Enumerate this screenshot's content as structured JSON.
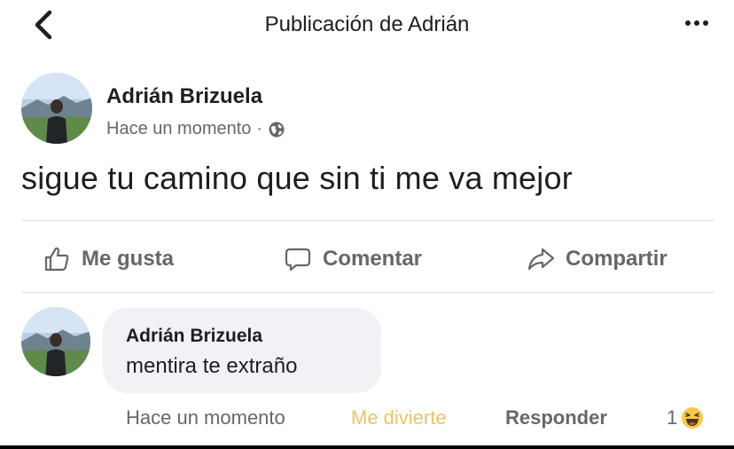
{
  "header": {
    "title": "Publicación de Adrián"
  },
  "post": {
    "author": "Adrián Brizuela",
    "timestamp": "Hace un momento",
    "separator": "·",
    "privacy_icon": "globe-icon",
    "text": "sigue tu camino que sin ti me va mejor"
  },
  "actions": {
    "like": "Me gusta",
    "comment": "Comentar",
    "share": "Compartir"
  },
  "comment": {
    "author": "Adrián Brizuela",
    "text": "mentira te extraño",
    "timestamp": "Hace un momento",
    "reaction_label": "Me divierte",
    "reply_label": "Responder",
    "reaction_count": "1",
    "reaction_icon": "haha-emoji-icon"
  },
  "colors": {
    "primary_text": "#1c1e21",
    "secondary_text": "#65676b",
    "reacted": "#e7c56a",
    "bubble": "#f0f2f5",
    "divider": "#dadde1"
  }
}
